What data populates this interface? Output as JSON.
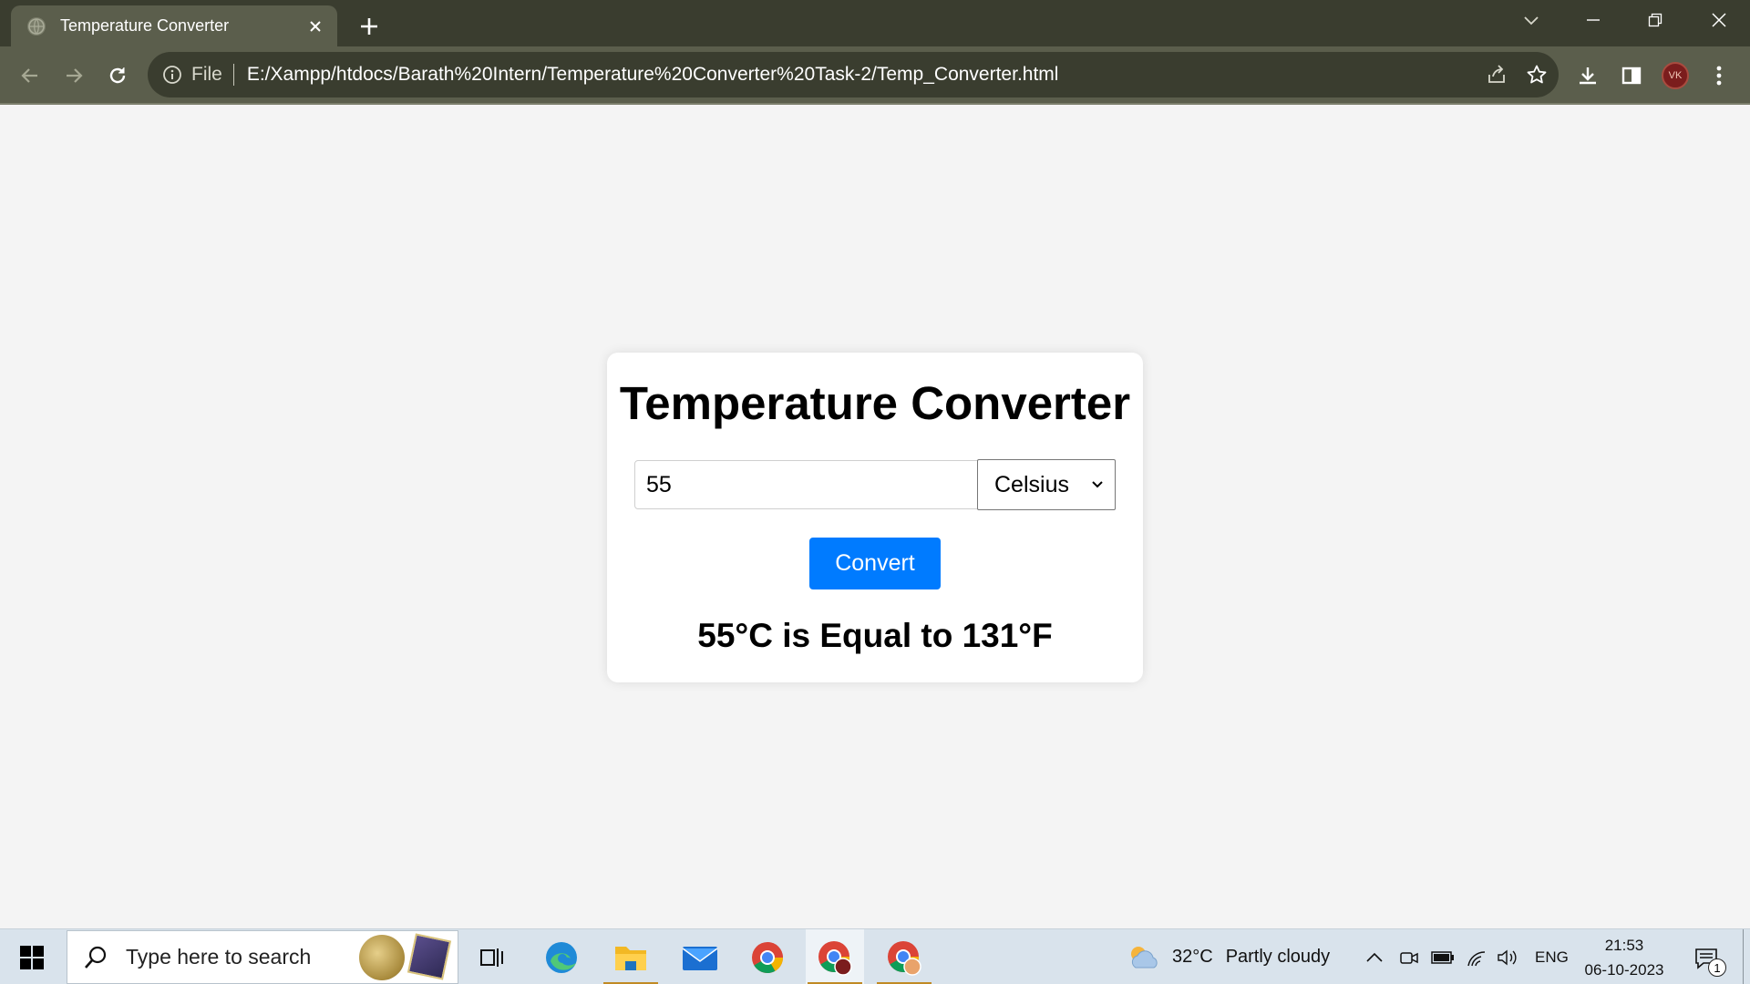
{
  "browser": {
    "tab_title": "Temperature Converter",
    "address_scheme": "File",
    "address_url": "E:/Xampp/htdocs/Barath%20Intern/Temperature%20Converter%20Task-2/Temp_Converter.html",
    "avatar_initials": "VK"
  },
  "app": {
    "heading": "Temperature Converter",
    "input_value": "55",
    "unit_selected": "Celsius",
    "convert_label": "Convert",
    "result_text": "55°C is Equal to 131°F",
    "accent_color": "#007bff"
  },
  "taskbar": {
    "search_placeholder": "Type here to search",
    "weather_temp": "32°C",
    "weather_desc": "Partly cloudy",
    "language": "ENG",
    "time": "21:53",
    "date": "06-10-2023",
    "notification_count": "1",
    "apps": [
      "task-view-icon",
      "edge-icon",
      "file-explorer-icon",
      "mail-icon",
      "chrome-icon",
      "chrome-profile-icon",
      "chrome-profile-icon"
    ]
  }
}
